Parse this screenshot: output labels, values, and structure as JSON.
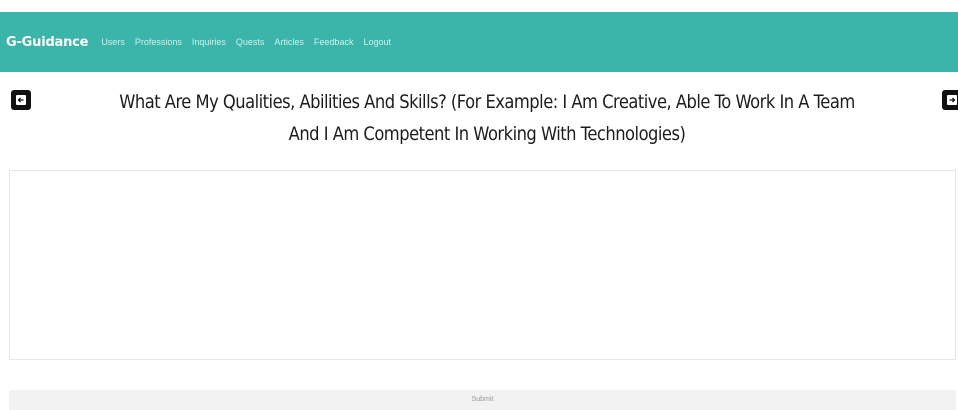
{
  "navbar": {
    "brand": "G-Guidance",
    "links": [
      "Users",
      "Professions",
      "Inquiries",
      "Quests",
      "Articles",
      "Feedback",
      "Logout"
    ],
    "background_color": "#3bb4a9"
  },
  "question": {
    "text": "What Are My Qualities, Abilities And Skills? (For Example: I Am Creative, Able To Work In A Team And I Am Competent In Working With Technologies)",
    "prev_icon": "arrow-left-icon",
    "next_icon": "arrow-right-icon"
  },
  "answer": {
    "value": "",
    "placeholder": ""
  },
  "submit": {
    "label": "Submit"
  }
}
